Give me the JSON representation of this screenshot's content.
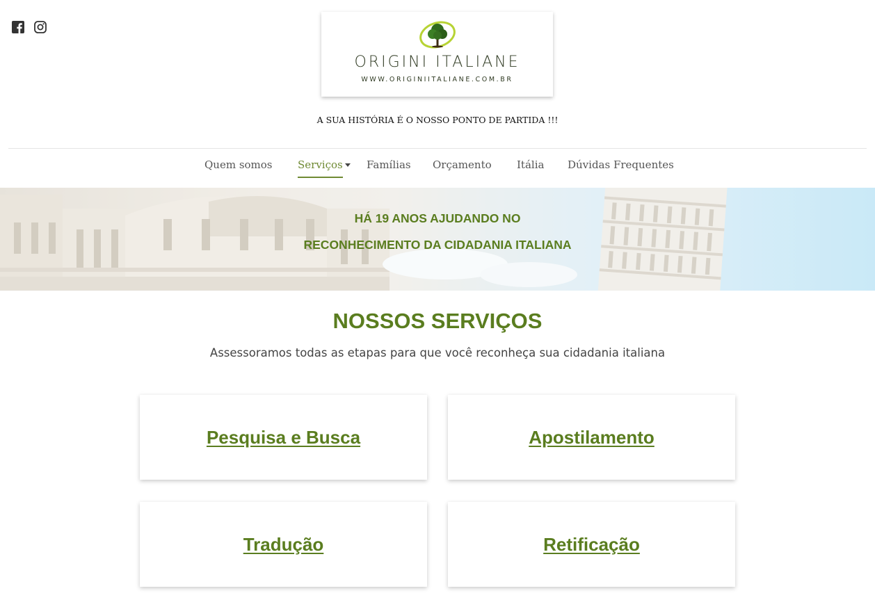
{
  "social": {
    "icons": [
      "facebook-icon",
      "instagram-icon"
    ]
  },
  "logo": {
    "name": "ORIGINI ITALIANE",
    "url": "WWW.ORIGINIITALIANE.COM.BR"
  },
  "tagline": "A SUA HISTÓRIA É O NOSSO PONTO DE PARTIDA !!!",
  "nav": {
    "items": [
      {
        "label": "Quem somos"
      },
      {
        "label": "Serviços"
      },
      {
        "label": "Famílias"
      },
      {
        "label": "Orçamento"
      },
      {
        "label": "Itália"
      },
      {
        "label": "Dúvidas Frequentes"
      }
    ],
    "active": "Serviços"
  },
  "hero": {
    "line1": "HÁ 19 ANOS AJUDANDO NO",
    "line2": "RECONHECIMENTO DA CIDADANIA ITALIANA"
  },
  "services": {
    "title": "NOSSOS SERVIÇOS",
    "subtitle": "Assessoramos todas as etapas para que você reconheça sua cidadania italiana",
    "cards": [
      {
        "label": "Pesquisa e Busca"
      },
      {
        "label": "Apostilamento"
      },
      {
        "label": "Tradução"
      },
      {
        "label": "Retificação"
      }
    ]
  },
  "colors": {
    "brand_green": "#5a7d1f",
    "nav_active": "#6f8a33"
  }
}
